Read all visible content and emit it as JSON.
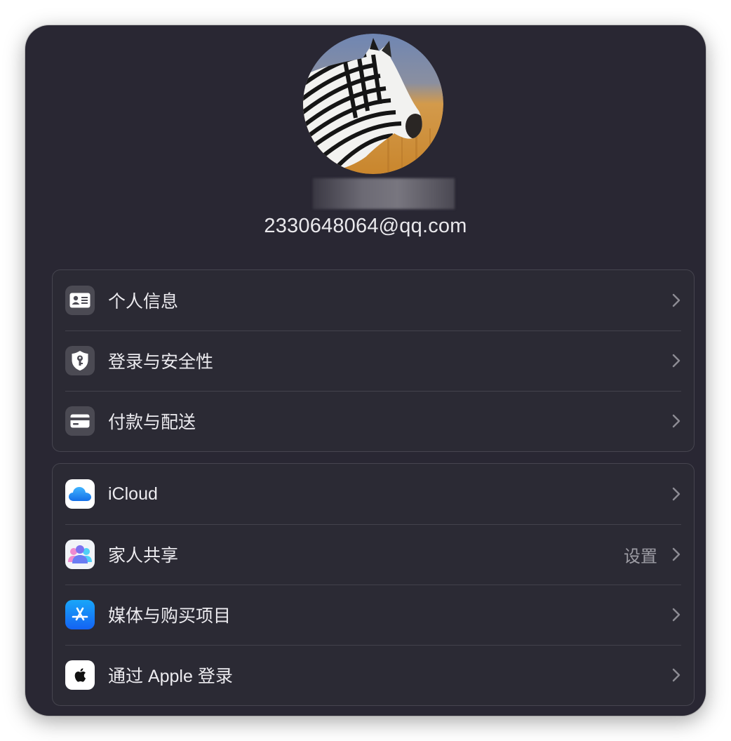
{
  "account": {
    "email": "2330648064@qq.com"
  },
  "groups": [
    {
      "items": [
        {
          "label": "个人信息",
          "icon": "contact-card-icon"
        },
        {
          "label": "登录与安全性",
          "icon": "shield-key-icon"
        },
        {
          "label": "付款与配送",
          "icon": "credit-card-icon"
        }
      ]
    },
    {
      "items": [
        {
          "label": "iCloud",
          "icon": "icloud-icon"
        },
        {
          "label": "家人共享",
          "icon": "family-sharing-icon",
          "detail": "设置"
        },
        {
          "label": "媒体与购买项目",
          "icon": "app-store-icon"
        },
        {
          "label": "通过 Apple 登录",
          "icon": "apple-logo-icon"
        }
      ]
    }
  ],
  "colors": {
    "window_bg": "#292733",
    "group_border": "#46454f",
    "text_primary": "#ecebef",
    "text_secondary": "#9e9da5",
    "icloud_blue": "#1b8cf2",
    "app_store_blue": "#1470f5"
  }
}
